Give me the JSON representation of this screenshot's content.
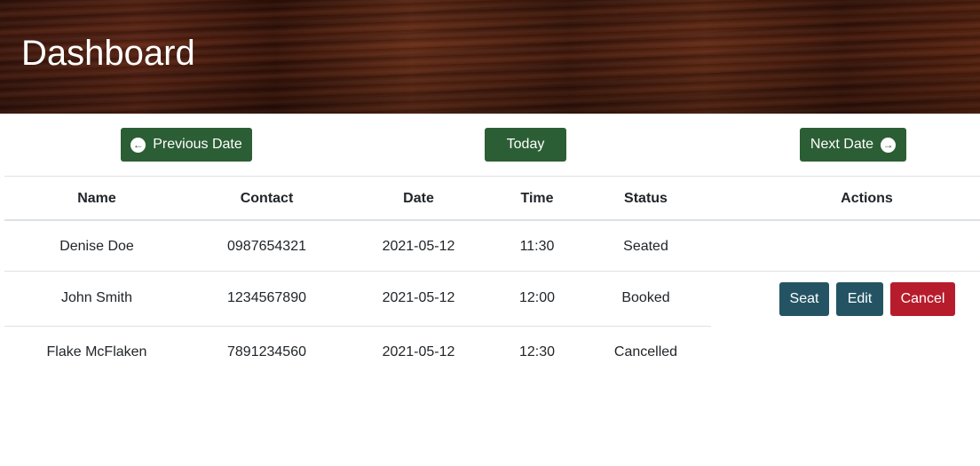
{
  "header": {
    "title": "Dashboard"
  },
  "navigation": {
    "previous_label": "Previous Date",
    "today_label": "Today",
    "next_label": "Next Date"
  },
  "table": {
    "columns": [
      "Name",
      "Contact",
      "Date",
      "Time",
      "Status",
      "Actions"
    ],
    "rows": [
      {
        "name": "Denise Doe",
        "contact": "0987654321",
        "date": "2021-05-12",
        "time": "11:30",
        "status": "Seated",
        "actions": []
      },
      {
        "name": "John Smith",
        "contact": "1234567890",
        "date": "2021-05-12",
        "time": "12:00",
        "status": "Booked",
        "actions": [
          "Seat",
          "Edit",
          "Cancel"
        ]
      },
      {
        "name": "Flake McFlaken",
        "contact": "7891234560",
        "date": "2021-05-12",
        "time": "12:30",
        "status": "Cancelled",
        "actions": []
      }
    ]
  },
  "colors": {
    "nav_button": "#2c5e35",
    "action_button": "#245464",
    "cancel_button": "#b71c2c"
  },
  "icons": {
    "previous": "arrow-circle-left-icon",
    "next": "arrow-circle-right-icon"
  }
}
